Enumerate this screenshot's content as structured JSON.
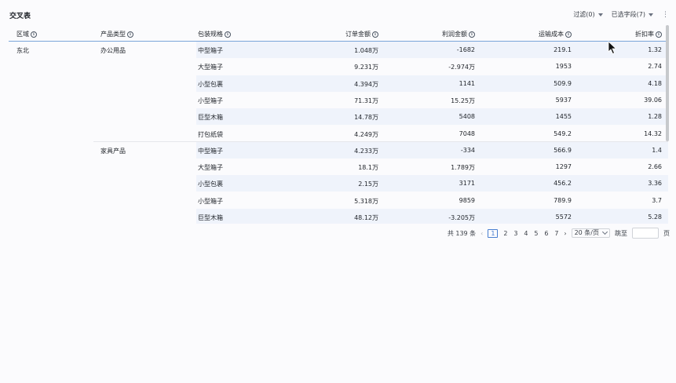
{
  "title": "交叉表",
  "toolbar": {
    "filter_label": "过滤(0)",
    "fields_label": "已选字段(7)",
    "more_label": "⋮"
  },
  "columns": [
    {
      "label": "区域"
    },
    {
      "label": "产品类型"
    },
    {
      "label": "包装规格"
    },
    {
      "label": "订单金额"
    },
    {
      "label": "利润金额"
    },
    {
      "label": "运输成本"
    },
    {
      "label": "折扣率"
    }
  ],
  "info_glyph": "i",
  "groups": {
    "region": "东北",
    "types": [
      "办公用品",
      "家具产品"
    ]
  },
  "rows": [
    {
      "pack": "中型箱子",
      "order": "1.048万",
      "profit": "-1682",
      "ship": "219.1",
      "discount": "1.32"
    },
    {
      "pack": "大型箱子",
      "order": "9.231万",
      "profit": "-2.974万",
      "ship": "1953",
      "discount": "2.74"
    },
    {
      "pack": "小型包裹",
      "order": "4.394万",
      "profit": "1141",
      "ship": "509.9",
      "discount": "4.18"
    },
    {
      "pack": "小型箱子",
      "order": "71.31万",
      "profit": "15.25万",
      "ship": "5937",
      "discount": "39.06"
    },
    {
      "pack": "巨型木箱",
      "order": "14.78万",
      "profit": "5408",
      "ship": "1455",
      "discount": "1.28"
    },
    {
      "pack": "打包纸袋",
      "order": "4.249万",
      "profit": "7048",
      "ship": "549.2",
      "discount": "14.32"
    },
    {
      "pack": "中型箱子",
      "order": "4.233万",
      "profit": "-334",
      "ship": "566.9",
      "discount": "1.4"
    },
    {
      "pack": "大型箱子",
      "order": "18.1万",
      "profit": "1.789万",
      "ship": "1297",
      "discount": "2.66"
    },
    {
      "pack": "小型包裹",
      "order": "2.15万",
      "profit": "3171",
      "ship": "456.2",
      "discount": "3.36"
    },
    {
      "pack": "小型箱子",
      "order": "5.318万",
      "profit": "9859",
      "ship": "789.9",
      "discount": "3.7"
    },
    {
      "pack": "巨型木箱",
      "order": "48.12万",
      "profit": "-3.205万",
      "ship": "5572",
      "discount": "5.28"
    }
  ],
  "pagination": {
    "total_label": "共 139 条",
    "prev": "‹",
    "next": "›",
    "pages": [
      "1",
      "2",
      "3",
      "4",
      "5",
      "6",
      "7"
    ],
    "current_page": "1",
    "page_size": "20 条/页",
    "jump_label": "跳至",
    "page_suffix": "页"
  },
  "colors": {
    "accent": "#4a7fd0",
    "stripe": "#eff3fb",
    "header_border": "#7aa5d9"
  }
}
